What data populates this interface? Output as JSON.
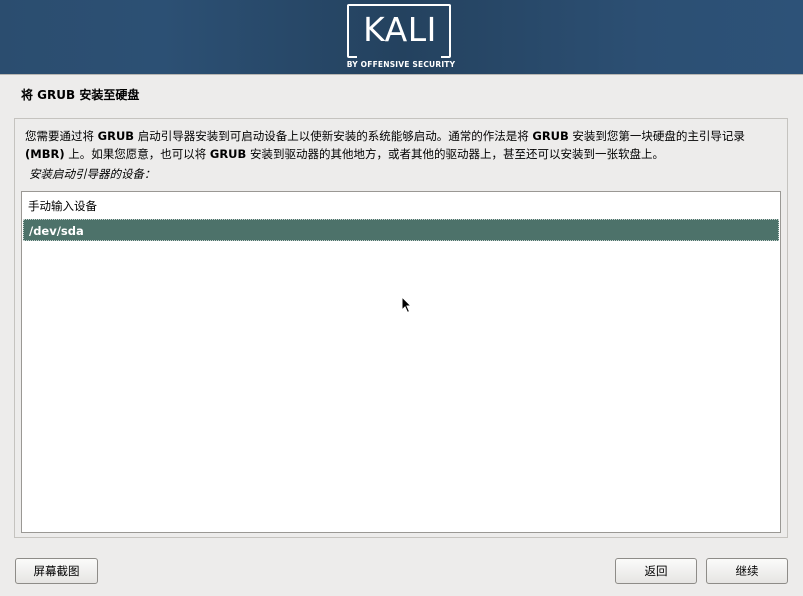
{
  "banner": {
    "logo_text": "KALI",
    "logo_subtitle": "BY OFFENSIVE SECURITY"
  },
  "page": {
    "title": "将 GRUB 安装至硬盘"
  },
  "description": {
    "line1_a": "您需要通过将 ",
    "line1_b": "GRUB",
    "line1_c": " 启动引导器安装到可启动设备上以使新安装的系统能够启动。通常的作法是将 ",
    "line1_d": "GRUB",
    "line1_e": " 安装到您第一块硬盘的主引导记录",
    "line2_a": "(MBR)",
    "line2_b": " 上。如果您愿意，也可以将 ",
    "line2_c": "GRUB",
    "line2_d": " 安装到驱动器的其他地方，或者其他的驱动器上，甚至还可以安装到一张软盘上。"
  },
  "device_list": {
    "label": "安装启动引导器的设备：",
    "items": [
      {
        "label": "手动输入设备",
        "selected": false
      },
      {
        "label": "/dev/sda",
        "selected": true
      }
    ]
  },
  "buttons": {
    "screenshot": "屏幕截图",
    "back": "返回",
    "continue": "继续"
  },
  "colors": {
    "banner": "#2b4d6f",
    "selection": "#4d726a",
    "background": "#edeceb"
  }
}
